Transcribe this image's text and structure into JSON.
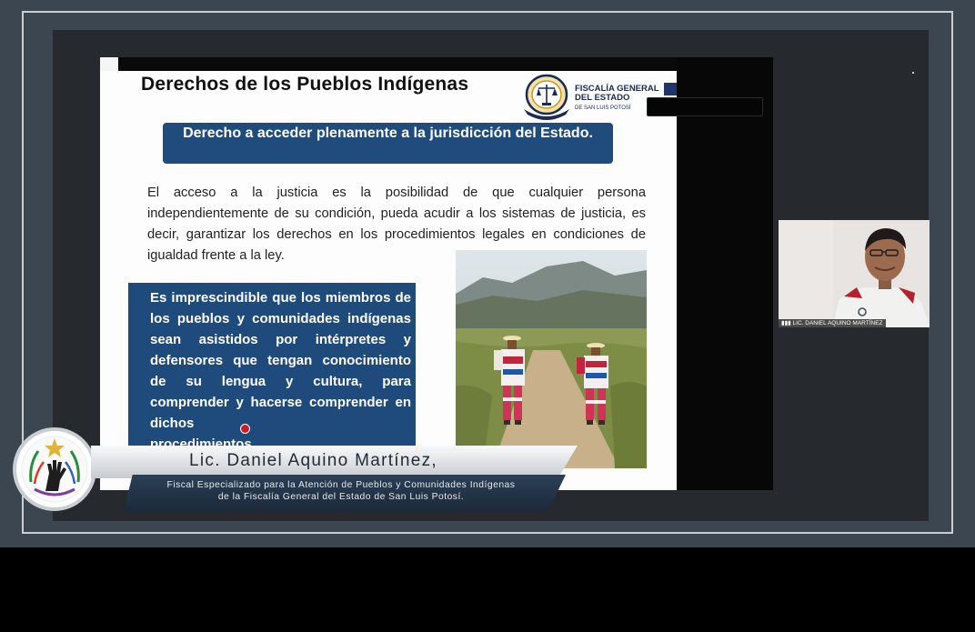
{
  "slide": {
    "title": "Derechos de los Pueblos Indígenas",
    "logo": {
      "line1": "FISCALÍA GENERAL",
      "line2": "DEL ESTADO",
      "line3": "DE SAN LUIS POTOSÍ"
    },
    "banner": "Derecho a acceder plenamente a la jurisdicción del Estado.",
    "paragraph": "El acceso a la justicia es la posibilidad de que cualquier persona independientemente de su condición, pueda acudir a los sistemas de justicia, es decir, garantizar los derechos en los procedimientos legales en condiciones de igualdad frente a la ley.",
    "highlight_main": "Es imprescindible que los miembros de los pueblos y comunidades indígenas sean asistidos por intérpretes y defensores que tengan conocimiento de su lengua y cultura, para comprender y hacerse comprender en dichos",
    "highlight_last": "procedimientos."
  },
  "participant": {
    "name_tag": "LIC. DANIEL AQUINO MARTÍNEZ"
  },
  "lower_third": {
    "name": "Lic. Daniel Aquino Martínez,",
    "role_line1": "Fiscal Especializado para la Atención de Pueblos y Comunidades Indígenas",
    "role_line2": "de la Fiscalía General del Estado de San Luis Potosí."
  },
  "colors": {
    "banner_blue": "#1f4b7d",
    "highlight_blue": "#1f4a7c",
    "frame_gray": "#3b4650",
    "emblem_gold": "#e0b43a"
  },
  "icons": {
    "seal": "fiscalia-seal-icon",
    "emblem": "indigenous-rights-hand-emblem-icon",
    "signal": "signal-bars-icon",
    "pointer": "laser-pointer-icon"
  }
}
